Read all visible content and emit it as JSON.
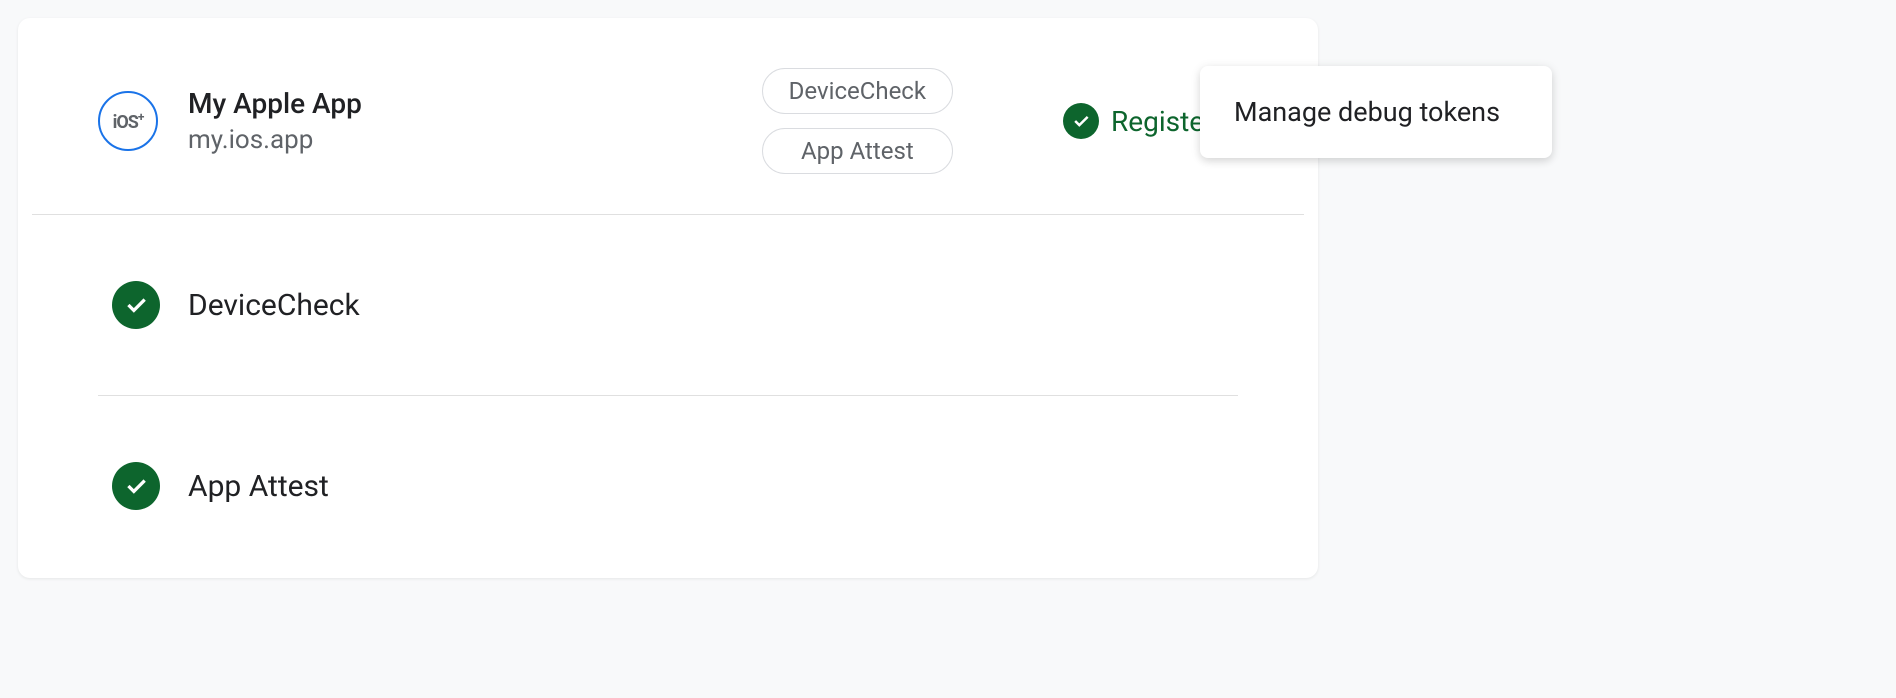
{
  "app": {
    "icon_label": "iOS+",
    "name": "My Apple App",
    "bundle_id": "my.ios.app"
  },
  "chips": {
    "device_check": "DeviceCheck",
    "app_attest": "App Attest"
  },
  "status": {
    "label": "Registered"
  },
  "providers": [
    {
      "name": "DeviceCheck"
    },
    {
      "name": "App Attest"
    }
  ],
  "popover": {
    "manage_tokens": "Manage debug tokens"
  }
}
